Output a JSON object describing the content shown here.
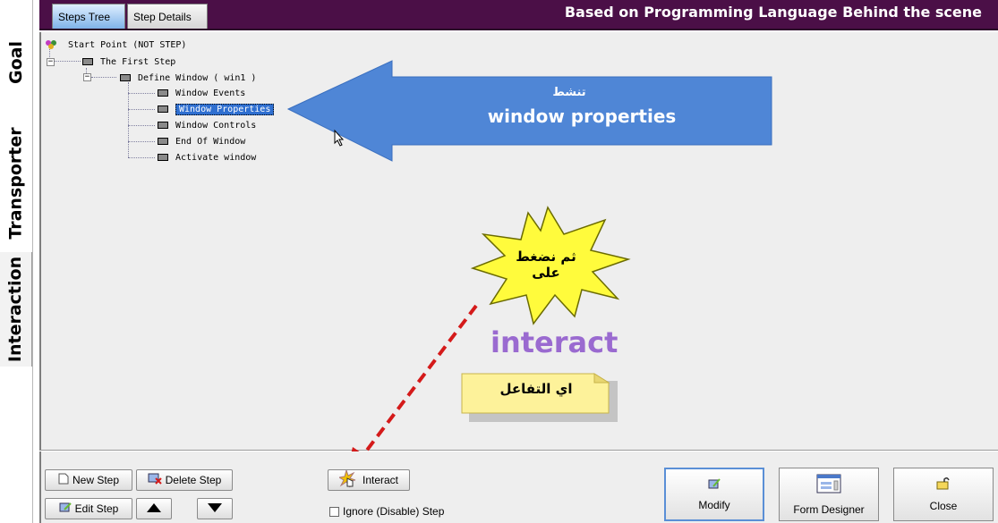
{
  "side_tabs": [
    "Goal",
    "Transporter",
    "Interaction"
  ],
  "header": {
    "tabs": [
      "Steps Tree",
      "Step Details"
    ],
    "title": "Based on Programming Language Behind the scene"
  },
  "tree": {
    "root": "Start Point (NOT STEP)",
    "first_step": "The First Step",
    "define_window": "Define Window  ( win1 )",
    "children": [
      "Window Events",
      "Window Properties",
      "Window Controls",
      "End Of Window",
      "Activate window"
    ],
    "selected": "Window Properties"
  },
  "annotations": {
    "arrow_arabic": "تنشط",
    "arrow_english": "window properties",
    "burst_line1": "ثم نضغط",
    "burst_line2": "على",
    "interact_word": "interact",
    "note_arabic": "اي التفاعل",
    "arrow_color": "#4f86d6",
    "burst_color": "#fffb3c",
    "dashed_arrow_color": "#d41a1a",
    "interact_color": "#9a6ad0"
  },
  "toolbar": {
    "new_step": "New Step",
    "delete_step": "Delete Step",
    "edit_step": "Edit Step",
    "interact": "Interact",
    "ignore_step": "Ignore (Disable) Step",
    "modify": "Modify",
    "form_designer": "Form Designer",
    "close": "Close"
  },
  "icons": [
    "new-step-icon",
    "delete-step-icon",
    "edit-step-icon",
    "move-up-icon",
    "move-down-icon",
    "interact-icon",
    "modify-icon",
    "form-designer-icon",
    "close-icon",
    "start-point-icon"
  ]
}
